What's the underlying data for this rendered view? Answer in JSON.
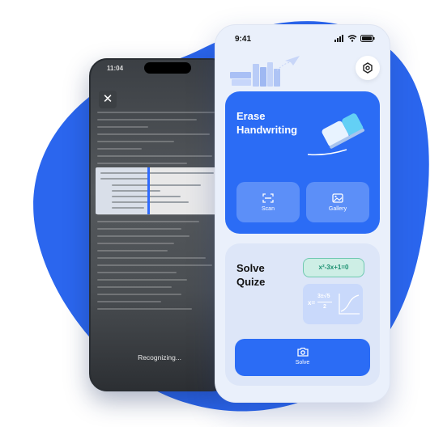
{
  "back_phone": {
    "time": "11:04",
    "status_text": "Recognizing..."
  },
  "front_phone": {
    "time": "9:41",
    "erase_card": {
      "title_line1": "Erase",
      "title_line2": "Handwriting",
      "scan_label": "Scan",
      "gallery_label": "Gallery"
    },
    "solve_card": {
      "title_line1": "Solve",
      "title_line2": "Quize",
      "equation": "x²-3x+1=0",
      "formula_left": "x=",
      "formula_num": "3±√5",
      "formula_den": "2",
      "solve_label": "Solve"
    }
  },
  "colors": {
    "primary": "#2b6cf5",
    "blob": "#2b66ee",
    "card_light": "#dde6f8",
    "equation_green": "#1a8f6f"
  },
  "icons": [
    "close-icon",
    "signal-icon",
    "wifi-icon",
    "battery-icon",
    "settings-icon",
    "scan-icon",
    "gallery-icon",
    "camera-icon",
    "eraser-icon",
    "books-icon",
    "paper-plane-icon"
  ]
}
